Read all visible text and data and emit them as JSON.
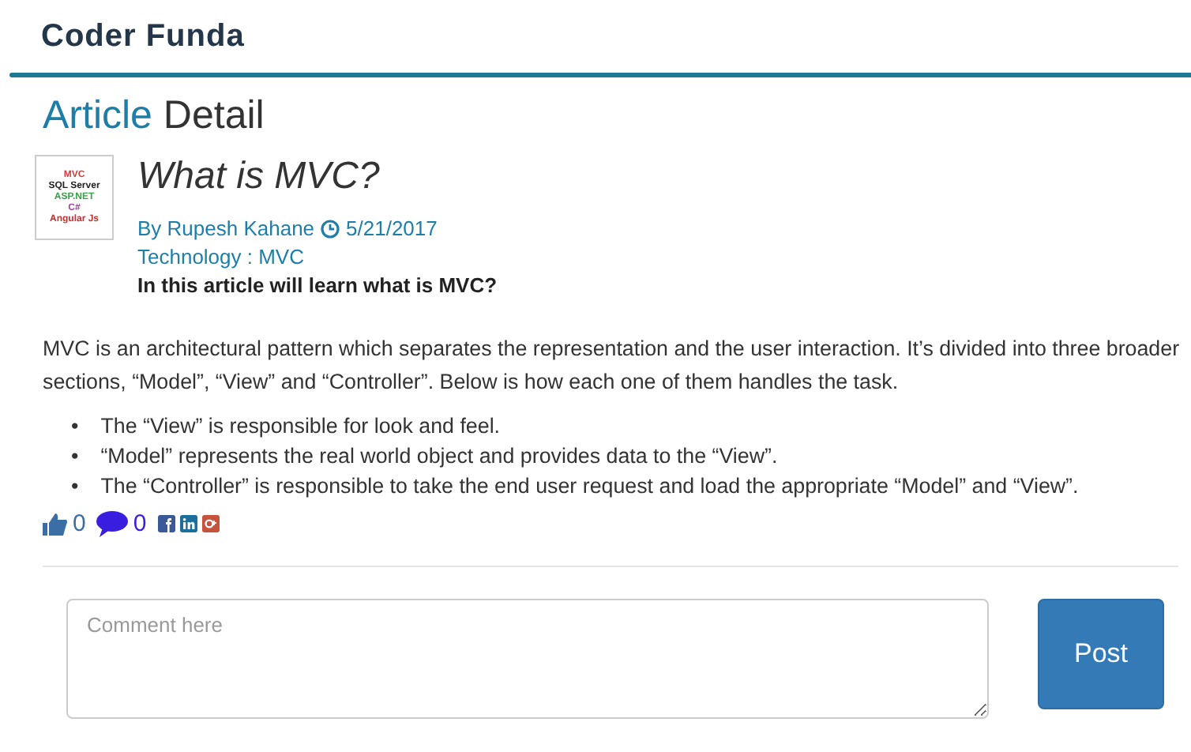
{
  "logo": {
    "text": "Coder Funda"
  },
  "page_title": {
    "accent": "Article",
    "rest": "Detail"
  },
  "thumbnail": {
    "lines": [
      {
        "text": "MVC",
        "color": "#d04040"
      },
      {
        "text": "SQL Server",
        "color": "#222222"
      },
      {
        "text": "ASP.NET",
        "color": "#3aa04a"
      },
      {
        "text": "C#",
        "color": "#a040a0"
      },
      {
        "text": "Angular Js",
        "color": "#c03030"
      }
    ]
  },
  "article": {
    "title": "What is MVC?",
    "author": "By Rupesh Kahane",
    "date": "5/21/2017",
    "category": "Technology : MVC",
    "summary": "In this article will learn what is MVC?",
    "body": "MVC is an architectural pattern which separates the representation and the user interaction. It’s divided into three broader sections, “Model”, “View” and “Controller”. Below is how each one of them handles the task.",
    "bullets": [
      {
        "marker": "•",
        "text": "The “View” is responsible for look and feel."
      },
      {
        "marker": "•",
        "text": "“Model” represents the real world object and provides data to the “View”."
      },
      {
        "marker": "•",
        "text": "The “Controller” is responsible to take the end user request and load the appropriate “Model” and “View”."
      }
    ]
  },
  "social": {
    "likes": "0",
    "comments": "0"
  },
  "comment": {
    "placeholder": "Comment here",
    "button": "Post"
  }
}
